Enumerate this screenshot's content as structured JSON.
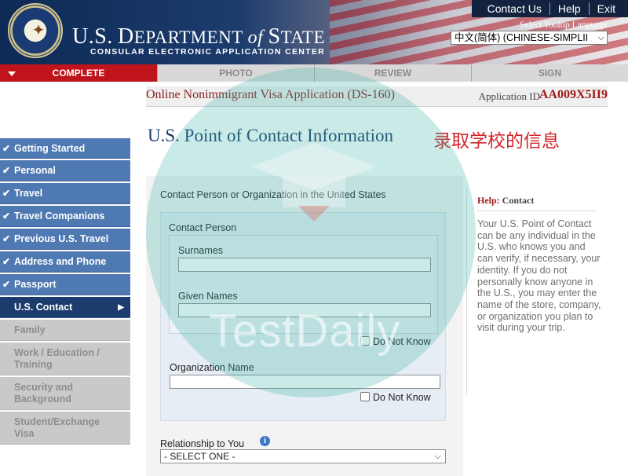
{
  "header": {
    "top_links": [
      "Contact Us",
      "Help",
      "Exit"
    ],
    "title_us": "U.S.",
    "title_dept_initial": "D",
    "title_dept_rest": "EPARTMENT",
    "title_of": "of",
    "title_state_initial": "S",
    "title_state_rest": "TATE",
    "subtitle": "CONSULAR ELECTRONIC APPLICATION CENTER",
    "language_label": "Select Tooltip Language",
    "language_selected": "中文(简体)  (CHINESE-SIMPLII"
  },
  "tabs": [
    "COMPLETE",
    "PHOTO",
    "REVIEW",
    "SIGN"
  ],
  "app": {
    "title": "Online Nonimmigrant Visa Application (DS-160)",
    "id_label": "Application ID",
    "id_value": "AA009X5II9"
  },
  "sidebar": {
    "items": [
      {
        "label": "Getting Started",
        "state": "done"
      },
      {
        "label": "Personal",
        "state": "done"
      },
      {
        "label": "Travel",
        "state": "done"
      },
      {
        "label": "Travel Companions",
        "state": "done"
      },
      {
        "label": "Previous U.S. Travel",
        "state": "done"
      },
      {
        "label": "Address and Phone",
        "state": "done"
      },
      {
        "label": "Passport",
        "state": "done"
      },
      {
        "label": "U.S. Contact",
        "state": "current"
      },
      {
        "label": "Family",
        "state": "todo"
      },
      {
        "label": "Work / Education / Training",
        "state": "todo"
      },
      {
        "label": "Security and Background",
        "state": "todo"
      },
      {
        "label": "Student/Exchange Visa",
        "state": "todo"
      }
    ]
  },
  "main": {
    "page_title": "U.S. Point of Contact Information",
    "annotation_cn": "录取学校的信息",
    "section_label": "Contact Person or Organization in the United States",
    "contact_person_label": "Contact Person",
    "surnames_label": "Surnames",
    "surnames_value": "",
    "given_names_label": "Given Names",
    "given_names_value": "",
    "do_not_know_1": "Do Not Know",
    "org_name_label": "Organization Name",
    "org_name_value": "",
    "do_not_know_2": "Do Not Know",
    "relationship_label": "Relationship to You",
    "relationship_selected": "- SELECT ONE -"
  },
  "help": {
    "heading_prefix": "Help:",
    "heading_topic": "Contact",
    "body": "Your U.S. Point of Contact can be any individual in the U.S. who knows you and can verify, if necessary, your identity. If you do not personally know anyone in the U.S., you may enter the name of the store, company, or organization you plan to visit during your trip."
  },
  "watermark": {
    "text": "TestDaily"
  },
  "colors": {
    "complete_tab": "#c0141c",
    "nav_done": "#4f79b2",
    "nav_current": "#1c3c6e",
    "nav_todo": "#c9c9c9",
    "page_title": "#1c3c6e",
    "annotation": "#d4262a",
    "watermark": "#3cb2aa"
  }
}
